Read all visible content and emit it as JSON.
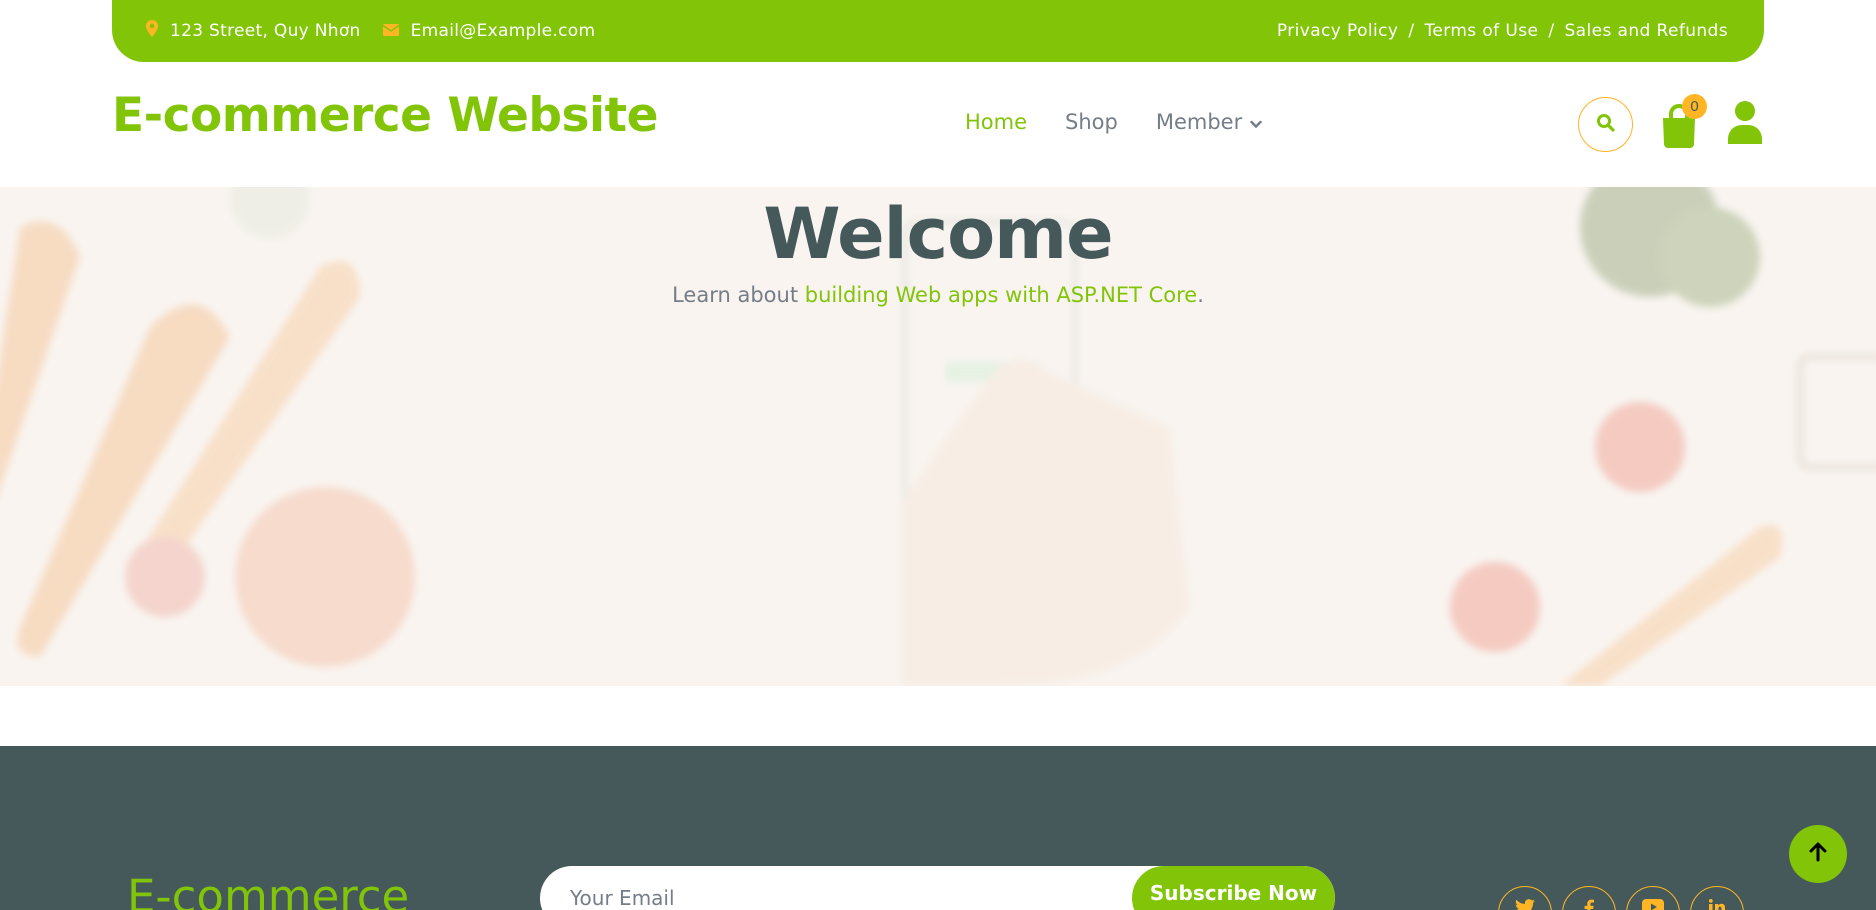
{
  "topbar": {
    "address": "123 Street, Quy Nhơn",
    "email": "Email@Example.com",
    "links": [
      "Privacy Policy",
      "Terms of Use",
      "Sales and Refunds"
    ],
    "separator": "/"
  },
  "header": {
    "brand": "E-commerce Website",
    "nav": [
      {
        "label": "Home",
        "active": true
      },
      {
        "label": "Shop",
        "active": false
      },
      {
        "label": "Member",
        "active": false,
        "dropdown": true
      }
    ],
    "cart_count": "0"
  },
  "hero": {
    "title": "Welcome",
    "lead_prefix": "Learn about ",
    "lead_link": "building Web apps with ASP.NET Core",
    "lead_suffix": "."
  },
  "footer": {
    "brand": "E-commerce",
    "email_placeholder": "Your Email",
    "subscribe_label": "Subscribe Now",
    "socials": [
      "twitter-icon",
      "facebook-icon",
      "youtube-icon",
      "linkedin-icon"
    ]
  },
  "colors": {
    "primary": "#81c408",
    "secondary": "#ffb524",
    "dark": "#45595b",
    "text": "#747d88"
  }
}
